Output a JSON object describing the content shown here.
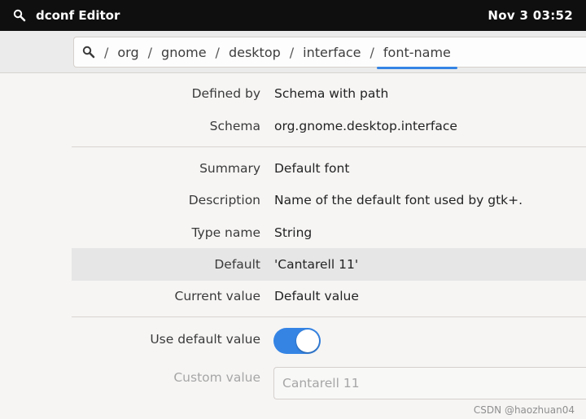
{
  "topbar": {
    "app_name": "dconf Editor",
    "clock": "Nov 3  03:52"
  },
  "path": {
    "crumbs": [
      "org",
      "gnome",
      "desktop",
      "interface",
      "font-name"
    ],
    "separator": "/"
  },
  "details": {
    "defined_by_label": "Defined by",
    "defined_by_value": "Schema with path",
    "schema_label": "Schema",
    "schema_value": "org.gnome.desktop.interface",
    "summary_label": "Summary",
    "summary_value": "Default font",
    "description_label": "Description",
    "description_value": "Name of the default font used by gtk+.",
    "type_label": "Type name",
    "type_value": "String",
    "default_label": "Default",
    "default_value": "'Cantarell 11'",
    "current_label": "Current value",
    "current_value": "Default value"
  },
  "settings": {
    "use_default_label": "Use default value",
    "use_default_on": true,
    "custom_label": "Custom value",
    "custom_value": "Cantarell 11"
  },
  "watermark": "CSDN @haozhuan04",
  "colors": {
    "accent": "#3584e4",
    "topbar": "#0f0f0f"
  }
}
